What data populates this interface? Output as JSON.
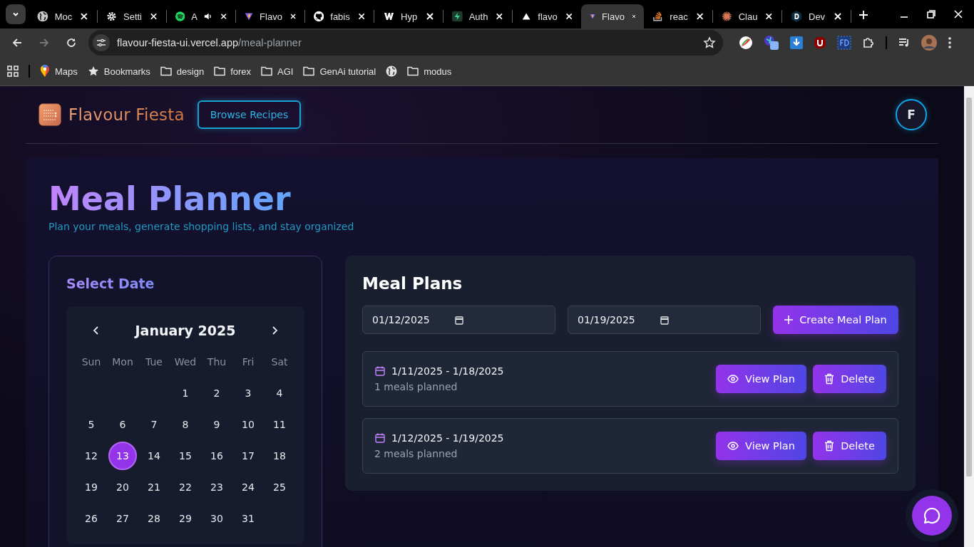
{
  "browser": {
    "tabs": [
      {
        "title": "Moc",
        "selected": false,
        "audio": false
      },
      {
        "title": "Setti",
        "selected": false,
        "audio": false
      },
      {
        "title": "A",
        "selected": false,
        "audio": true
      },
      {
        "title": "Flavo",
        "selected": false,
        "audio": false
      },
      {
        "title": "fabis",
        "selected": false,
        "audio": false
      },
      {
        "title": "Hyp",
        "selected": false,
        "audio": false
      },
      {
        "title": "Auth",
        "selected": false,
        "audio": false
      },
      {
        "title": "flavo",
        "selected": false,
        "audio": false
      },
      {
        "title": "Flavo",
        "selected": true,
        "audio": false
      },
      {
        "title": "reac",
        "selected": false,
        "audio": false
      },
      {
        "title": "Clau",
        "selected": false,
        "audio": false
      },
      {
        "title": "Dev",
        "selected": false,
        "audio": false
      }
    ],
    "url": {
      "host": "flavour-fiesta-ui.vercel.app",
      "path": "/meal-planner"
    },
    "bookmarks": [
      {
        "kind": "maps",
        "label": "Maps"
      },
      {
        "kind": "star",
        "label": "Bookmarks"
      },
      {
        "kind": "folder",
        "label": "design"
      },
      {
        "kind": "folder",
        "label": "forex"
      },
      {
        "kind": "folder",
        "label": "AGI"
      },
      {
        "kind": "folder",
        "label": "GenAi tutorial"
      },
      {
        "kind": "site"
      },
      {
        "kind": "folder",
        "label": "modus"
      }
    ]
  },
  "header": {
    "brand": "Flavour Fiesta",
    "nav_button": "Browse Recipes",
    "avatar": "F"
  },
  "page": {
    "title": "Meal Planner",
    "subtitle": "Plan your meals, generate shopping lists, and stay organized"
  },
  "calendar": {
    "title": "Select Date",
    "month": "January 2025",
    "weekdays": [
      "Sun",
      "Mon",
      "Tue",
      "Wed",
      "Thu",
      "Fri",
      "Sat"
    ],
    "weeks": [
      {
        "kind": "first",
        "days": [
          {
            "label": "1",
            "selected": false
          },
          {
            "label": "2",
            "selected": false
          },
          {
            "label": "3",
            "selected": false
          },
          {
            "label": "4",
            "selected": false
          }
        ]
      },
      {
        "kind": "full",
        "days": [
          {
            "label": "5",
            "selected": false
          },
          {
            "label": "6",
            "selected": false
          },
          {
            "label": "7",
            "selected": false
          },
          {
            "label": "8",
            "selected": false
          },
          {
            "label": "9",
            "selected": false
          },
          {
            "label": "10",
            "selected": false
          },
          {
            "label": "11",
            "selected": false
          }
        ]
      },
      {
        "kind": "full",
        "days": [
          {
            "label": "12",
            "selected": false
          },
          {
            "label": "13",
            "selected": true
          },
          {
            "label": "14",
            "selected": false
          },
          {
            "label": "15",
            "selected": false
          },
          {
            "label": "16",
            "selected": false
          },
          {
            "label": "17",
            "selected": false
          },
          {
            "label": "18",
            "selected": false
          }
        ]
      },
      {
        "kind": "full",
        "days": [
          {
            "label": "19",
            "selected": false
          },
          {
            "label": "20",
            "selected": false
          },
          {
            "label": "21",
            "selected": false
          },
          {
            "label": "22",
            "selected": false
          },
          {
            "label": "23",
            "selected": false
          },
          {
            "label": "24",
            "selected": false
          },
          {
            "label": "25",
            "selected": false
          }
        ]
      },
      {
        "kind": "last",
        "days": [
          {
            "label": "26",
            "selected": false
          },
          {
            "label": "27",
            "selected": false
          },
          {
            "label": "28",
            "selected": false
          },
          {
            "label": "29",
            "selected": false
          },
          {
            "label": "30",
            "selected": false
          },
          {
            "label": "31",
            "selected": false
          }
        ]
      }
    ]
  },
  "meal_plans": {
    "title": "Meal Plans",
    "start_date": "01/12/2025",
    "end_date": "01/19/2025",
    "create_button": "Create Meal Plan",
    "plans": [
      {
        "range": "1/11/2025 - 1/18/2025",
        "meals": "1 meals planned",
        "view_button": "View Plan",
        "delete_button": "Delete"
      },
      {
        "range": "1/12/2025 - 1/19/2025",
        "meals": "2 meals planned",
        "view_button": "View Plan",
        "delete_button": "Delete"
      }
    ]
  }
}
